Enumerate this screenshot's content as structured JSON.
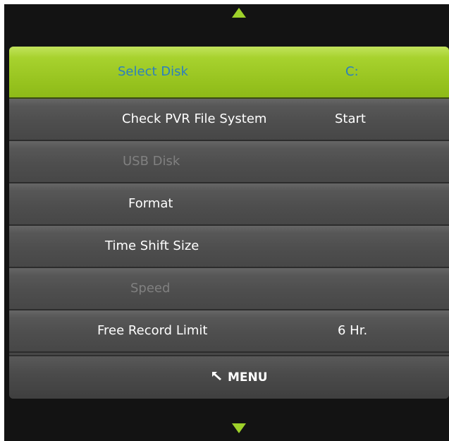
{
  "menu": {
    "items": [
      {
        "label": "Select Disk",
        "value": "C:",
        "state": "selected"
      },
      {
        "label": "Check PVR File System",
        "value": "Start",
        "state": "enabled"
      },
      {
        "label": "USB Disk",
        "value": "",
        "state": "disabled"
      },
      {
        "label": "Format",
        "value": "",
        "state": "enabled"
      },
      {
        "label": "Time Shift Size",
        "value": "",
        "state": "enabled"
      },
      {
        "label": "Speed",
        "value": "",
        "state": "disabled"
      },
      {
        "label": "Free Record Limit",
        "value": "6 Hr.",
        "state": "enabled"
      }
    ]
  },
  "footer": {
    "menu_label": "MENU",
    "icon": "return-arrow-icon"
  },
  "navigation": {
    "up_icon": "arrow-up-icon",
    "down_icon": "arrow-down-icon"
  },
  "colors": {
    "accent": "#9ed12a",
    "selected_text": "#2b7fbf",
    "enabled_text": "#ffffff",
    "disabled_text": "#808080",
    "background": "#131313"
  }
}
